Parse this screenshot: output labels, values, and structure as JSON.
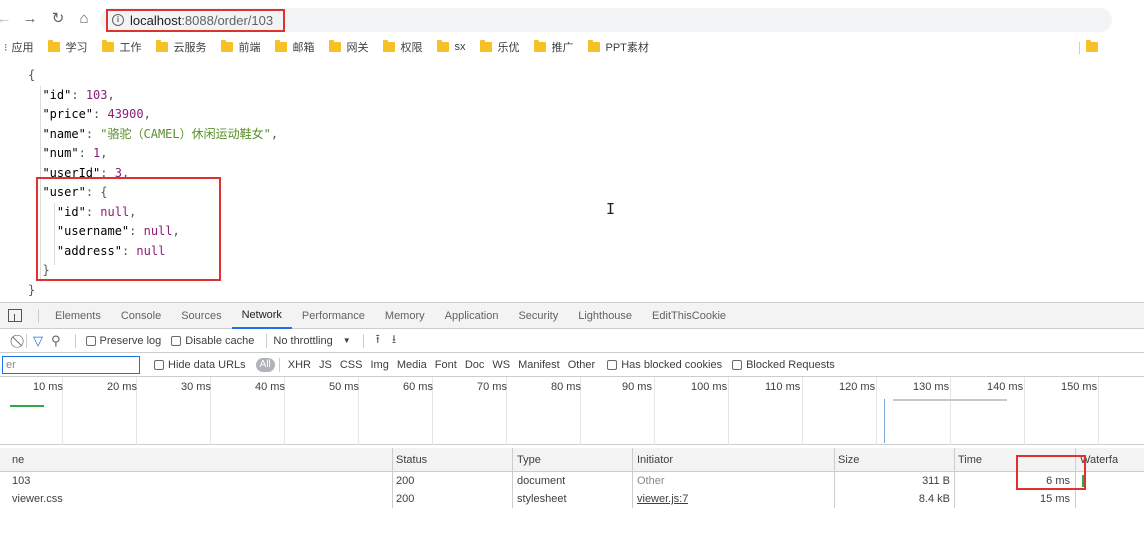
{
  "browser": {
    "url_host": "localhost",
    "url_rest": ":8088/order/103"
  },
  "bookmarks": {
    "apps_label": "应用",
    "items": [
      "学习",
      "工作",
      "云服务",
      "前端",
      "邮箱",
      "网关",
      "权限",
      "sx",
      "乐优",
      "推广",
      "PPT素材"
    ]
  },
  "json_lines": [
    "{",
    "\"id\": 103,",
    "\"price\": 43900,",
    "\"name\": \"骆驼（CAMEL）休闲运动鞋女\",",
    "\"num\": 1,",
    "\"userId\": 3,",
    "\"user\": {",
    "\"id\": null,",
    "\"username\": null,",
    "\"address\": null",
    "}",
    "}"
  ],
  "json": {
    "id": "103",
    "price": "43900",
    "name": "\"骆驼（CAMEL）休闲运动鞋女\"",
    "num": "1",
    "userId": "3",
    "user_id": "null",
    "user_username": "null",
    "user_address": "null"
  },
  "devtools": {
    "tabs": [
      "Elements",
      "Console",
      "Sources",
      "Network",
      "Performance",
      "Memory",
      "Application",
      "Security",
      "Lighthouse",
      "EditThisCookie"
    ],
    "active_tab": "Network",
    "controls": {
      "preserve_log": "Preserve log",
      "disable_cache": "Disable cache",
      "throttling": "No throttling"
    },
    "filter": {
      "input_text": "er",
      "hide_data_urls": "Hide data URLs",
      "all": "All",
      "types": [
        "XHR",
        "JS",
        "CSS",
        "Img",
        "Media",
        "Font",
        "Doc",
        "WS",
        "Manifest",
        "Other"
      ],
      "has_blocked_cookies": "Has blocked cookies",
      "blocked_requests": "Blocked Requests"
    },
    "timeline_ticks": [
      "10 ms",
      "20 ms",
      "30 ms",
      "40 ms",
      "50 ms",
      "60 ms",
      "70 ms",
      "80 ms",
      "90 ms",
      "100 ms",
      "110 ms",
      "120 ms",
      "130 ms",
      "140 ms",
      "150 ms"
    ],
    "columns": {
      "name": "ne",
      "status": "Status",
      "type": "Type",
      "initiator": "Initiator",
      "size": "Size",
      "time": "Time",
      "waterfall": "Waterfa"
    },
    "rows": [
      {
        "name": "103",
        "status": "200",
        "type": "document",
        "initiator": "Other",
        "size": "311 B",
        "time": "6 ms"
      },
      {
        "name": "viewer.css",
        "status": "200",
        "type": "stylesheet",
        "initiator": "viewer.js:7",
        "size": "8.4 kB",
        "time": "15 ms"
      }
    ]
  }
}
